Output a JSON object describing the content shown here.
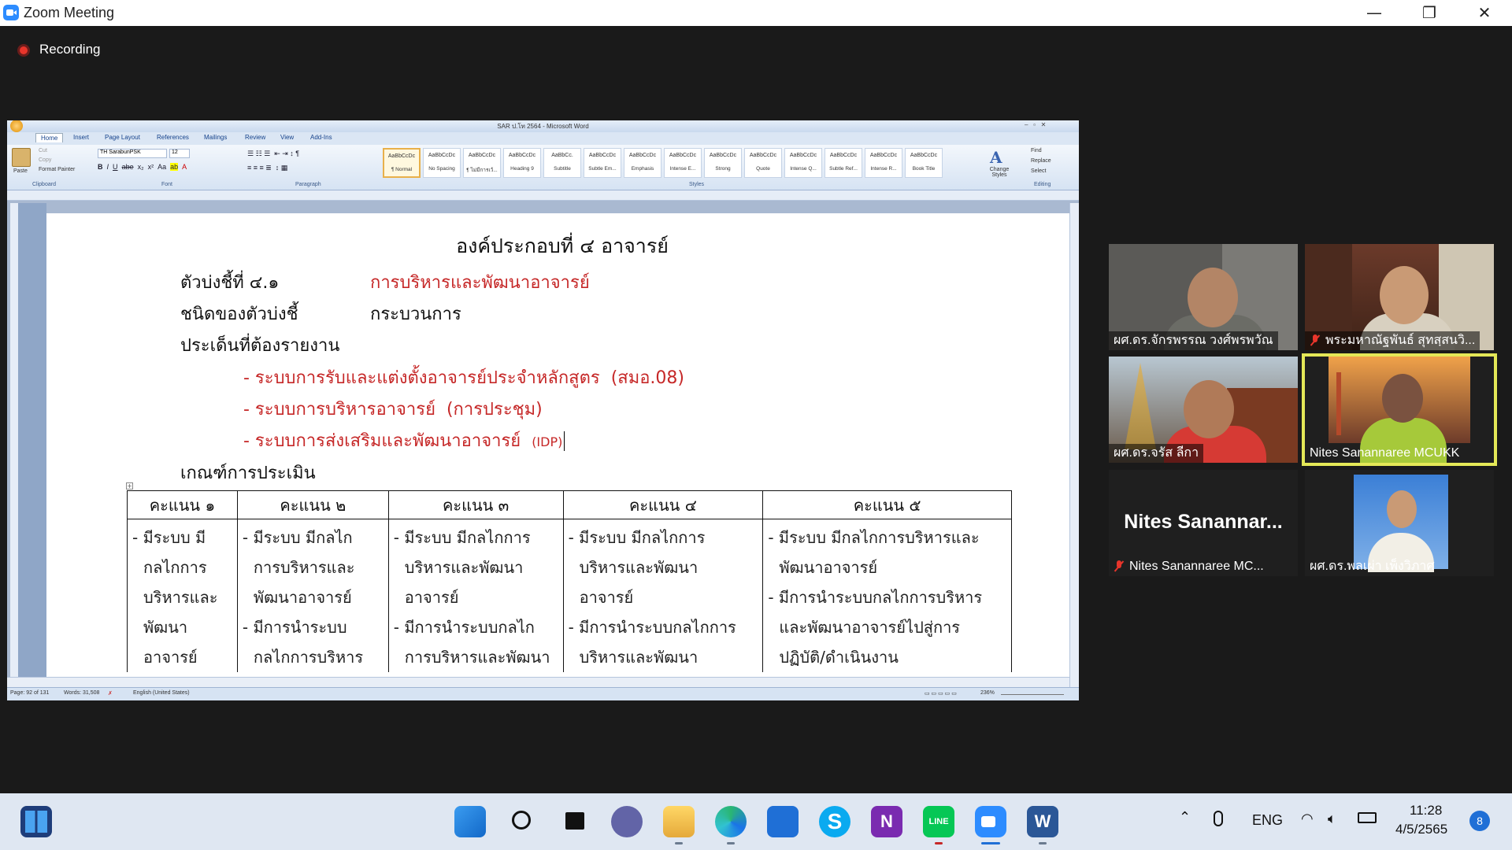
{
  "window": {
    "title": "Zoom Meeting",
    "controls": {
      "minimize": "—",
      "restore": "❐",
      "close": "✕"
    }
  },
  "recording": {
    "label": "Recording",
    "color": "#e8352b"
  },
  "word": {
    "title": "SAR ป.โท 2564 - Microsoft Word",
    "tabs": [
      "Home",
      "Insert",
      "Page Layout",
      "References",
      "Mailings",
      "Review",
      "View",
      "Add-Ins"
    ],
    "clipboard": {
      "paste": "Paste",
      "cut": "Cut",
      "copy": "Copy",
      "format_painter": "Format Painter",
      "label": "Clipboard"
    },
    "font": {
      "name": "TH SarabunPSK",
      "size": "12",
      "label": "Font"
    },
    "paragraph_label": "Paragraph",
    "styles": [
      {
        "preview": "AaBbCcDc",
        "name": "¶ Normal",
        "selected": true
      },
      {
        "preview": "AaBbCcDc",
        "name": "No Spacing"
      },
      {
        "preview": "AaBbCcDc",
        "name": "¶ ไม่มีการเว้..."
      },
      {
        "preview": "AaBbCcDc",
        "name": "Heading 9"
      },
      {
        "preview": "AaBbCc.",
        "name": "Subtitle"
      },
      {
        "preview": "AaBbCcDc",
        "name": "Subtle Em..."
      },
      {
        "preview": "AaBbCcDc",
        "name": "Emphasis"
      },
      {
        "preview": "AaBbCcDc",
        "name": "Intense E..."
      },
      {
        "preview": "AaBbCcDc",
        "name": "Strong"
      },
      {
        "preview": "AaBbCcDc",
        "name": "Quote"
      },
      {
        "preview": "AaBbCcDc",
        "name": "Intense Q..."
      },
      {
        "preview": "AaBbCcDc",
        "name": "Subtle Ref..."
      },
      {
        "preview": "AaBbCcDc",
        "name": "Intense R..."
      },
      {
        "preview": "AaBbCcDc",
        "name": "Book Title"
      }
    ],
    "styles_label": "Styles",
    "change_styles": "Change Styles",
    "editing": {
      "find": "Find",
      "replace": "Replace",
      "select": "Select",
      "label": "Editing"
    },
    "status": {
      "page": "Page: 92 of 131",
      "words": "Words: 31,508",
      "language": "English (United States)",
      "zoom": "236%"
    }
  },
  "document": {
    "title": "องค์ประกอบที่ ๔ อาจารย์",
    "indicator_label": "ตัวบ่งชี้ที่ ๔.๑",
    "indicator_value": "การบริหารและพัฒนาอาจารย์",
    "type_label": "ชนิดของตัวบ่งชี้",
    "type_value": "กระบวนการ",
    "issues_label": "ประเด็นที่ต้องรายงาน",
    "issues": [
      {
        "text": "- ระบบการรับและแต่งตั้งอาจารย์ประจำหลักสูตร",
        "note": "(สมอ.08)"
      },
      {
        "text": "- ระบบการบริหารอาจารย์",
        "note": "(การประชุม)"
      },
      {
        "text": "- ระบบการส่งเสริมและพัฒนาอาจารย์",
        "note": "(IDP)"
      }
    ],
    "criteria_label": "เกณฑ์การประเมิน",
    "table": {
      "headers": [
        "คะแนน ๑",
        "คะแนน ๒",
        "คะแนน ๓",
        "คะแนน ๔",
        "คะแนน ๕"
      ],
      "cells": [
        [
          "- มีระบบ มี",
          "กลไกการ",
          "บริหารและ",
          "พัฒนา",
          "อาจารย์"
        ],
        [
          "- มีระบบ มีกลไก",
          "การบริหารและ",
          "พัฒนาอาจารย์",
          "- มีการนำระบบ",
          "กลไกการบริหาร"
        ],
        [
          "- มีระบบ มีกลไกการ",
          "บริหารและพัฒนา",
          "อาจารย์",
          "- มีการนำระบบกลไก",
          "การบริหารและพัฒนา"
        ],
        [
          "- มีระบบ มีกลไกการ",
          "บริหารและพัฒนา",
          "อาจารย์",
          "- มีการนำระบบกลไกการ",
          "บริหารและพัฒนา"
        ],
        [
          "- มีระบบ มีกลไกการบริหารและ",
          "พัฒนาอาจารย์",
          "- มีการนำระบบกลไกการบริหาร",
          "และพัฒนาอาจารย์ไปสู่การ",
          "ปฏิบัติ/ดำเนินงาน"
        ]
      ]
    }
  },
  "participants": [
    {
      "name": "ผศ.ดร.จักรพรรณ วงศ์พรพวัณ",
      "muted": false
    },
    {
      "name": "พระมหาณัฐพันธ์ สุทสฺสนวิ...",
      "muted": true
    },
    {
      "name": "ผศ.ดร.จรัส ลีกา",
      "muted": false
    },
    {
      "name": "Nites Sanannaree MCUKK",
      "muted": false,
      "active_speaker": true
    },
    {
      "name": "Nites Sanannaree MC...",
      "muted": true,
      "placeholder": "Nites  Sanannar..."
    },
    {
      "name": "ผศ.ดร.พลเผ่า เพ็งวิภาศ",
      "muted": false
    }
  ],
  "taskbar": {
    "apps": [
      "start-icon",
      "search-icon",
      "task-view-icon",
      "chat-icon",
      "file-explorer-icon",
      "edge-icon",
      "mail-icon",
      "skype-icon",
      "onenote-icon",
      "line-icon",
      "zoom-icon",
      "word-icon"
    ],
    "language": "ENG",
    "time": "11:28",
    "date": "4/5/2565",
    "notifications": "8"
  }
}
